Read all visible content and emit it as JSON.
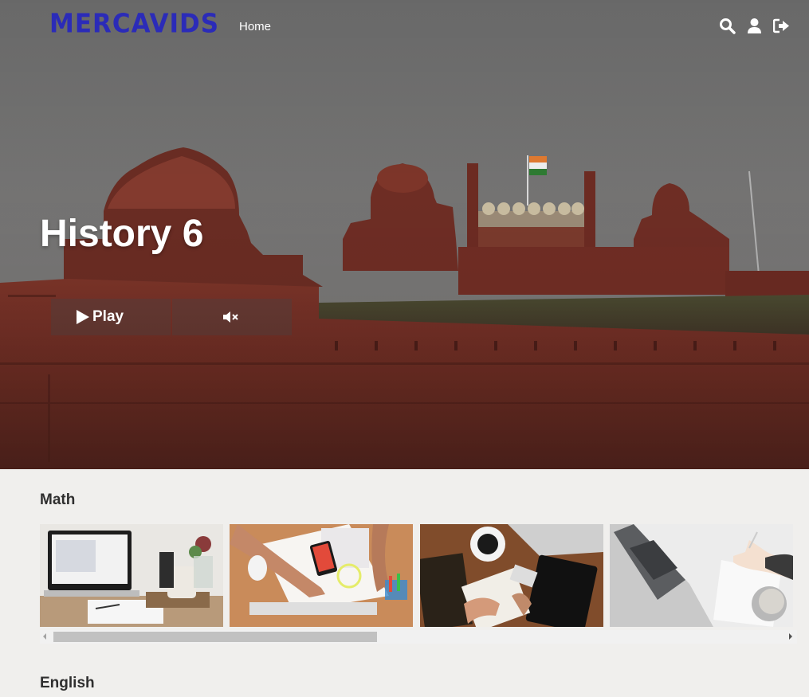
{
  "header": {
    "logo": "MERCAVIDS",
    "nav": [
      {
        "label": "Home"
      }
    ],
    "icons": [
      "search-icon",
      "user-icon",
      "sign-out-icon"
    ]
  },
  "hero": {
    "title": "History 6",
    "play_label": "Play",
    "mute_icon": "volume-mute-icon"
  },
  "rows": [
    {
      "title": "Math",
      "thumbnails": [
        {
          "name": "laptop-desk-thumbnail"
        },
        {
          "name": "hands-with-phone-thumbnail"
        },
        {
          "name": "desk-with-coffee-thumbnail"
        },
        {
          "name": "laptop-writing-thumbnail"
        }
      ],
      "scroll_position": 0
    },
    {
      "title": "English"
    }
  ],
  "colors": {
    "logo": "#2b2bb8",
    "page_background": "#f0efed",
    "fort": "#6b2a22",
    "sky": "#6f6f6f"
  }
}
